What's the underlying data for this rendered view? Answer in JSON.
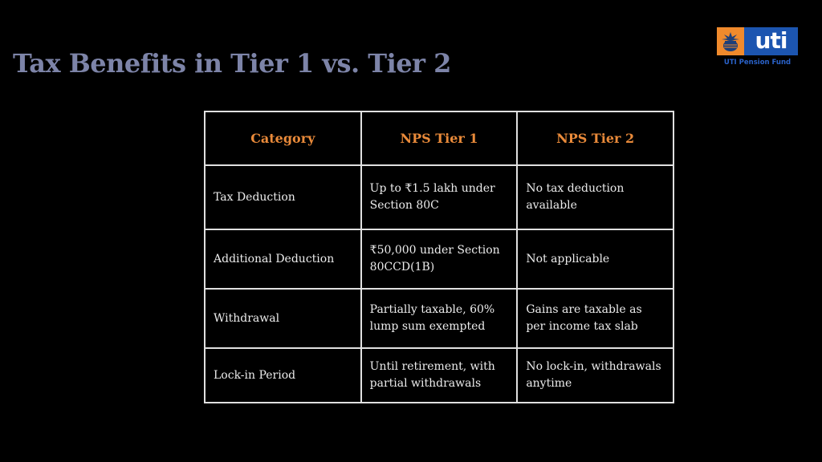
{
  "slide": {
    "title": "Tax Benefits in Tier 1 vs. Tier 2"
  },
  "logo": {
    "icon": "kalash-pot-icon",
    "wordmark": "uti",
    "subtitle": "UTI Pension Fund",
    "colors": {
      "orange": "#f08a2c",
      "blue": "#1c55b0"
    }
  },
  "table": {
    "headers": [
      "Category",
      "NPS Tier 1",
      "NPS Tier 2"
    ],
    "rows": [
      [
        "Tax Deduction",
        "Up to ₹1.5 lakh under Section 80C",
        "No tax deduction available"
      ],
      [
        "Additional Deduction",
        "₹50,000 under Section 80CCD(1B)",
        "Not applicable"
      ],
      [
        "Withdrawal",
        "Partially taxable, 60% lump sum exempted",
        "Gains are taxable as per income tax slab"
      ],
      [
        "Lock-in Period",
        "Until retirement, with partial withdrawals",
        "No lock-in, withdrawals anytime"
      ]
    ]
  },
  "colors": {
    "background": "#000000",
    "title": "#7d84a8",
    "header_text": "#e98a3a",
    "cell_text": "#ececec",
    "border": "#e0e0e0"
  }
}
